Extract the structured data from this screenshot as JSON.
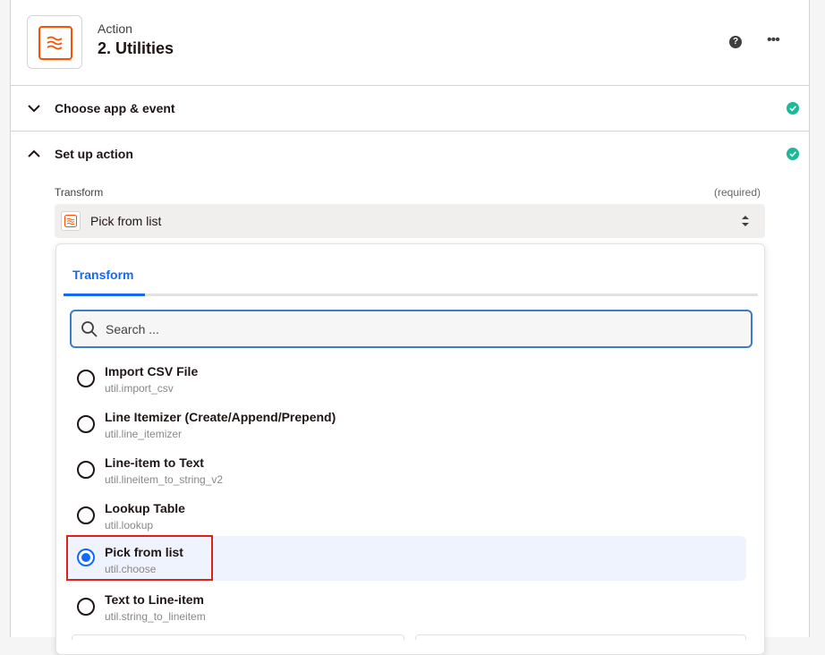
{
  "header": {
    "kind": "Action",
    "title": "2. Utilities",
    "help_icon": "question-circle-icon",
    "more_icon": "more-horizontal-icon",
    "brand_color": "#ff4f00"
  },
  "sections": [
    {
      "label": "Choose app & event",
      "state": "collapsed",
      "status": "complete"
    },
    {
      "label": "Set up action",
      "state": "expanded",
      "status": "complete"
    }
  ],
  "field": {
    "label": "Transform",
    "required_text": "(required)",
    "selected_value": "Pick from list"
  },
  "dropdown": {
    "tab_label": "Transform",
    "search_placeholder": "Search ...",
    "accent_color": "#136bf5",
    "options": [
      {
        "title": "Import CSV File",
        "key": "util.import_csv",
        "selected": false
      },
      {
        "title": "Line Itemizer (Create/Append/Prepend)",
        "key": "util.line_itemizer",
        "selected": false
      },
      {
        "title": "Line-item to Text",
        "key": "util.lineitem_to_string_v2",
        "selected": false
      },
      {
        "title": "Lookup Table",
        "key": "util.lookup",
        "selected": false
      },
      {
        "title": "Pick from list",
        "key": "util.choose",
        "selected": true
      },
      {
        "title": "Text to Line-item",
        "key": "util.string_to_lineitem",
        "selected": false
      }
    ]
  }
}
